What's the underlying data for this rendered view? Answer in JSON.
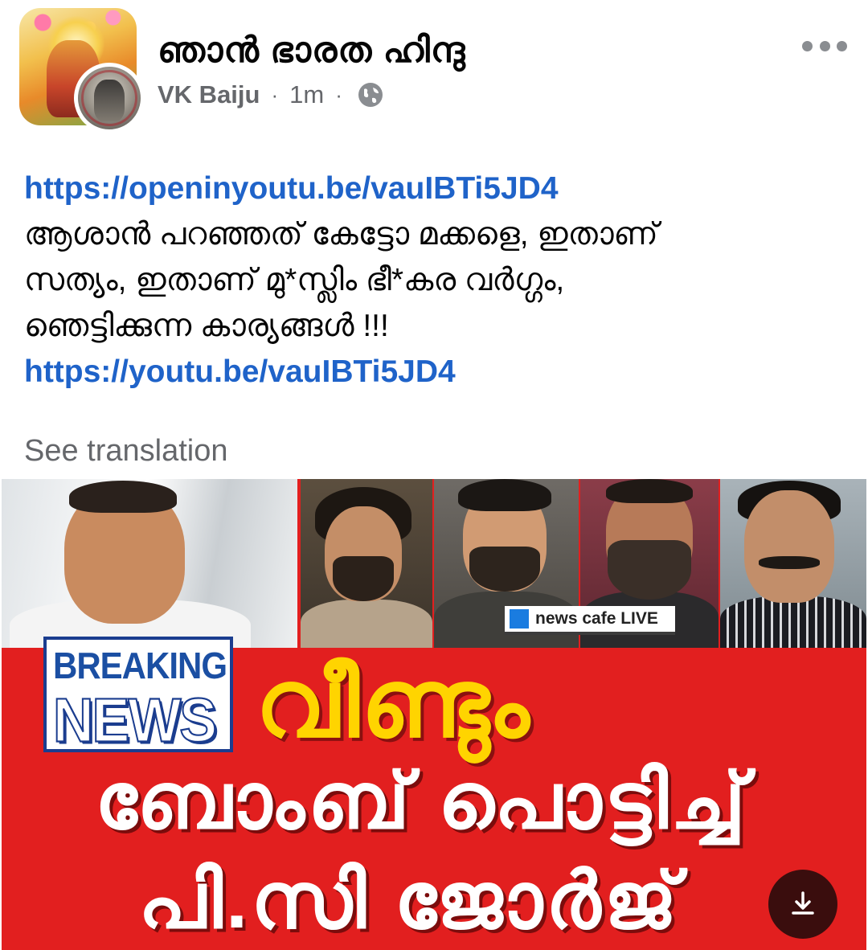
{
  "header": {
    "group_name": "ഞാൻ ഭാരത ഹിന്ദു",
    "author": "VK Baiju",
    "separator": "·",
    "time": "1m",
    "privacy_icon": "globe-icon",
    "more_icon": "more-options-icon"
  },
  "post": {
    "link_1": "https://openinyoutu.be/vauIBTi5JD4",
    "text_line_1": "ആശാൻ പറഞ്ഞത് കേട്ടോ മക്കളെ, ഇതാണ്",
    "text_line_2": "സത്യം, ഇതാണ് മു*സ്ലിം ഭീ*കര വർഗ്ഗം,",
    "text_line_3": "ഞെട്ടിക്കുന്ന കാര്യങ്ങൾ !!!",
    "link_2": "https://youtu.be/vauIBTi5JD4",
    "see_translation": "See translation"
  },
  "image": {
    "live_badge": "news cafe LIVE",
    "breaking_label": "BREAKING",
    "news_label": "NEWS",
    "headline_1": "വീണ്ടും",
    "headline_2": "ബോംബ് പൊട്ടിച്ച്",
    "headline_3": "പി.സി ജോർജ്",
    "download_icon": "download-icon",
    "colors": {
      "background": "#e21f1f",
      "headline_1": "#ffd400",
      "headline_2": "#ffffff",
      "breaking": "#1b4fa3"
    }
  },
  "colors": {
    "link": "#1f63c9",
    "meta": "#65676b"
  }
}
